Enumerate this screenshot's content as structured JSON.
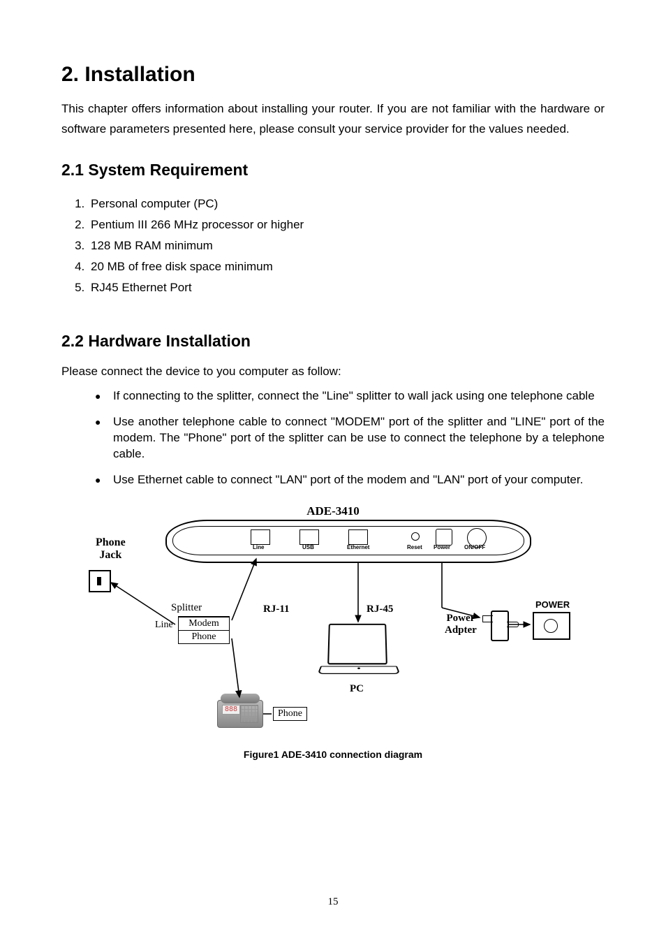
{
  "heading": "2. Installation",
  "intro": "This chapter offers information about installing your router. If you are not familiar with the hardware or software parameters presented here, please consult your service provider for the values needed.",
  "section1_title": "2.1 System Requirement",
  "requirements": [
    "Personal computer (PC)",
    "Pentium III 266 MHz processor or higher",
    "128 MB RAM minimum",
    "20 MB of free disk space minimum",
    "RJ45 Ethernet Port"
  ],
  "section2_title": "2.2 Hardware Installation",
  "section2_intro": "Please connect the device to you computer as follow:",
  "bullets": [
    "If connecting to the splitter, connect the \"Line\" splitter to wall jack using one telephone cable",
    "Use another telephone cable to connect \"MODEM\" port of the splitter and \"LINE\" port of the modem. The \"Phone\" port of the splitter can be use to connect the telephone by a telephone cable.",
    "Use Ethernet cable to connect \"LAN\" port of the modem and \"LAN\" port of your computer."
  ],
  "diagram": {
    "title": "ADE-3410",
    "phone_jack": "Phone\nJack",
    "splitter": "Splitter",
    "splitter_line": "Line",
    "splitter_modem": "Modem",
    "splitter_phone": "Phone",
    "rj11": "RJ-11",
    "rj45": "RJ-45",
    "power_adapter": "Power\nAdpter",
    "power": "POWER",
    "pc": "PC",
    "phone_label": "Phone",
    "router_ports": {
      "line": "Line",
      "usb": "USB",
      "ethernet": "Ethernet",
      "reset": "Reset",
      "power": "Power",
      "onoff": "ON/OFF"
    }
  },
  "figure_caption": "Figure1 ADE-3410 connection diagram",
  "page_number": "15"
}
